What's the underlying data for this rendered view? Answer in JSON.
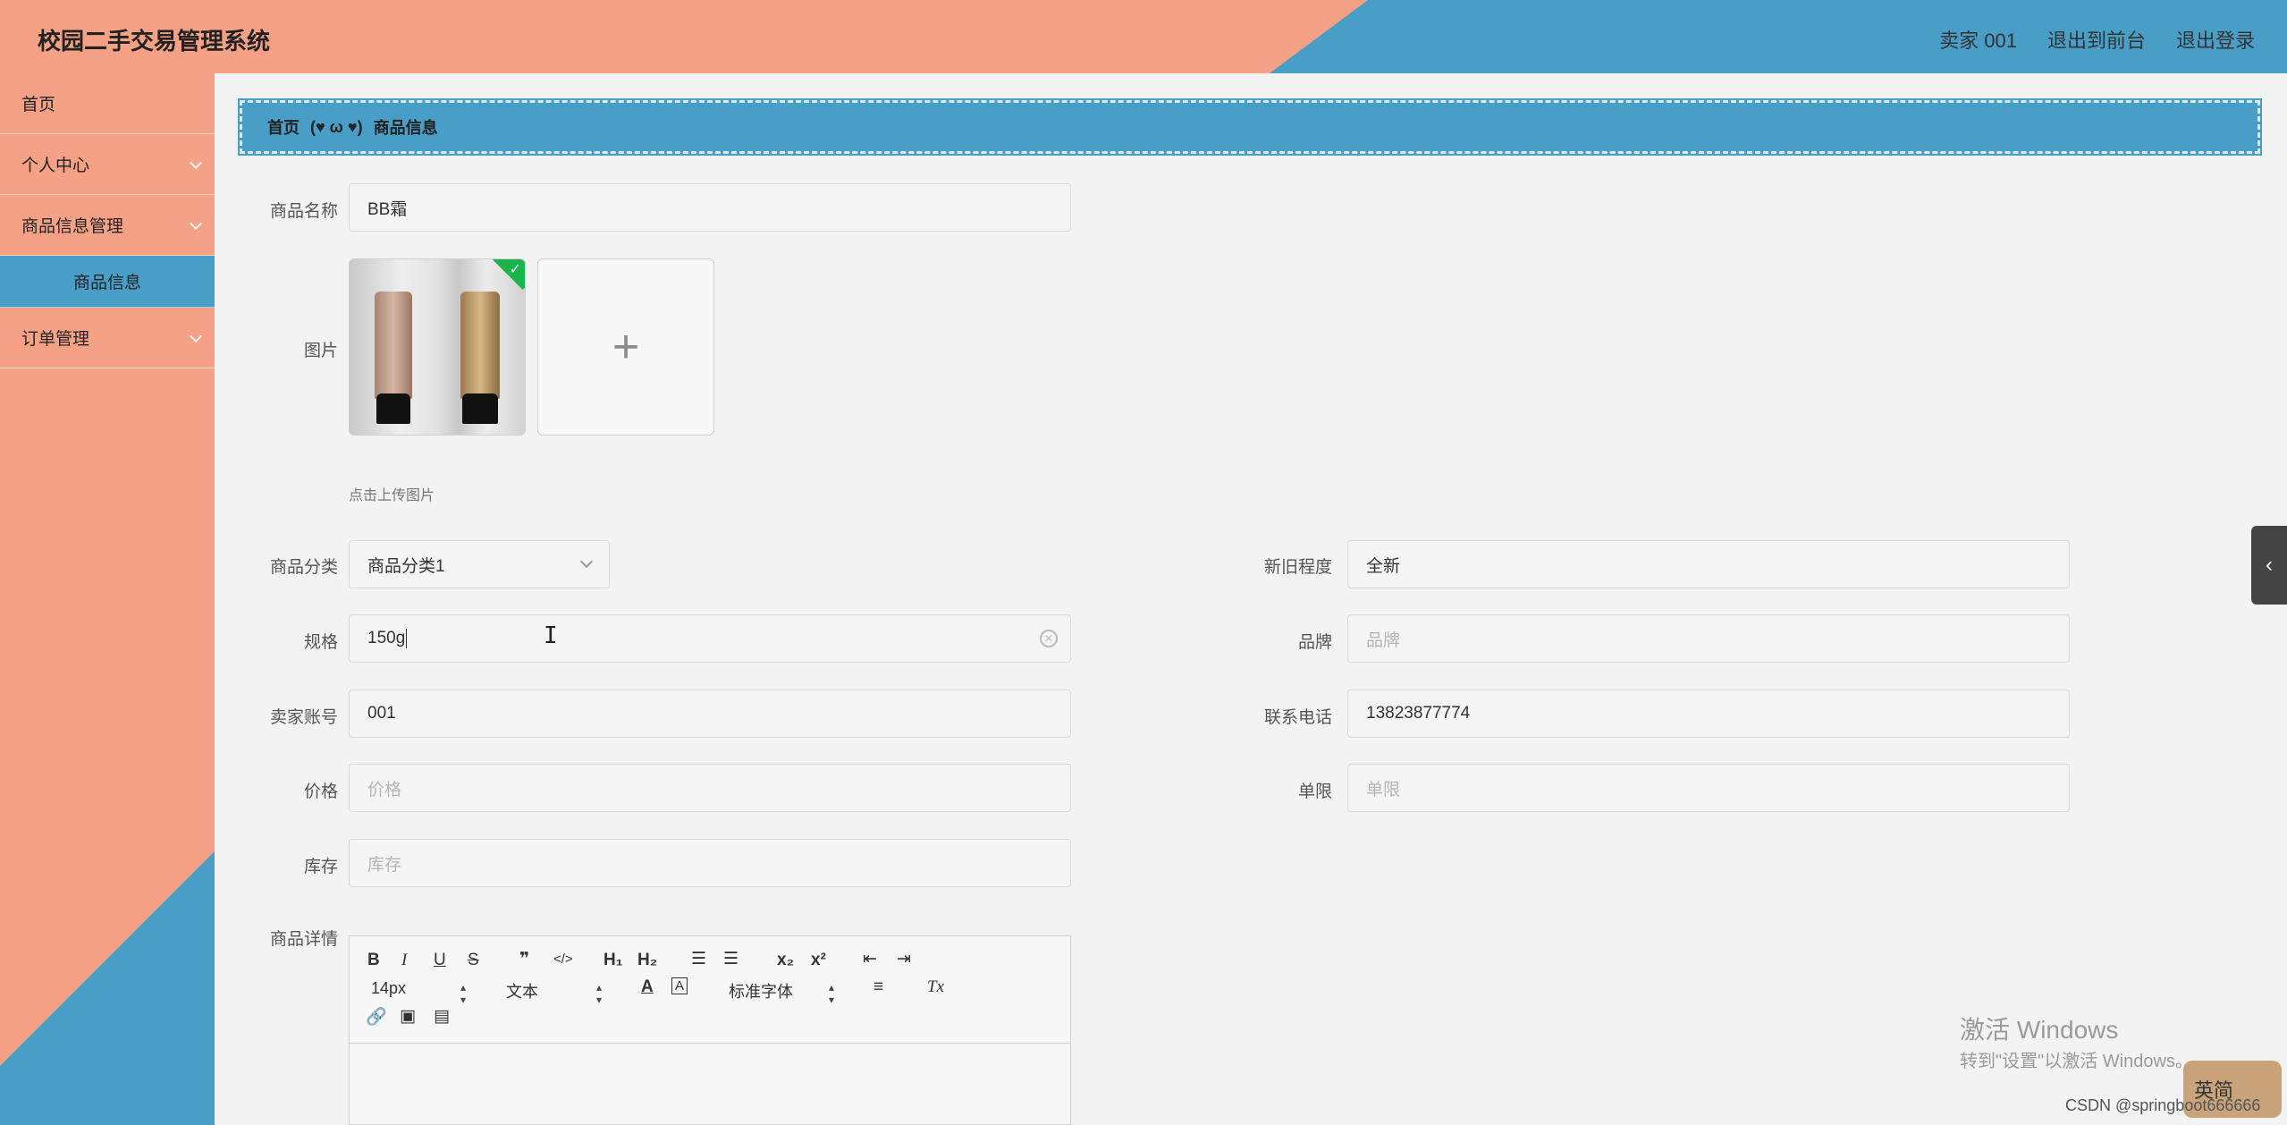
{
  "header": {
    "title": "校园二手交易管理系统",
    "nav": [
      "卖家 001",
      "退出到前台",
      "退出登录"
    ]
  },
  "sidebar": {
    "items": [
      {
        "label": "首页"
      },
      {
        "label": "个人中心"
      },
      {
        "label": "商品信息管理"
      },
      {
        "label": "商品信息"
      },
      {
        "label": "订单管理"
      }
    ]
  },
  "breadcrumb": {
    "home": "首页",
    "separator": "(♥ ω ♥)",
    "current": "商品信息"
  },
  "form": {
    "name": {
      "label": "商品名称",
      "value": "BB霜"
    },
    "image": {
      "label": "图片",
      "tip": "点击上传图片",
      "add": "+"
    },
    "category": {
      "label": "商品分类",
      "value": "商品分类1"
    },
    "condition": {
      "label": "新旧程度",
      "value": "全新"
    },
    "spec": {
      "label": "规格",
      "value": "150g"
    },
    "brand": {
      "label": "品牌",
      "placeholder": "品牌"
    },
    "seller": {
      "label": "卖家账号",
      "value": "001"
    },
    "phone": {
      "label": "联系电话",
      "value": "13823877774"
    },
    "price": {
      "label": "价格",
      "placeholder": "价格"
    },
    "limit": {
      "label": "单限",
      "placeholder": "单限"
    },
    "stock": {
      "label": "库存",
      "placeholder": "库存"
    },
    "details": {
      "label": "商品详情"
    }
  },
  "editor": {
    "font_size": "14px",
    "header_select": "文本",
    "font_family": "标准字体",
    "bold": "B",
    "italic": "I",
    "underline": "U",
    "strike": "S",
    "quote": "❞",
    "code": "</>",
    "h1": "H₁",
    "h2": "H₂",
    "sub": "x₂",
    "sup": "x²",
    "clear": "Tx"
  },
  "watermark": {
    "line1": "激活 Windows",
    "line2": "转到\"设置\"以激活 Windows。",
    "csdn": "CSDN @springboot666666",
    "ime": "英简"
  },
  "colors": {
    "salmon": "#f5a185",
    "blue": "#499ec8"
  }
}
